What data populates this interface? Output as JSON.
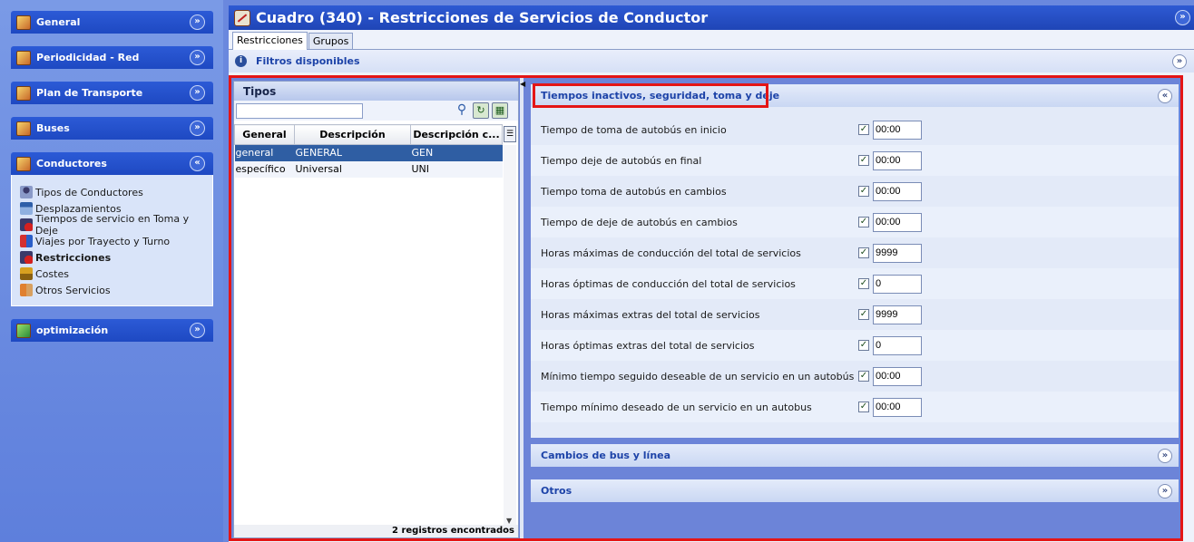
{
  "sidebar": {
    "groups": [
      {
        "title": "General"
      },
      {
        "title": "Periodicidad - Red"
      },
      {
        "title": "Plan de Transporte"
      },
      {
        "title": "Buses"
      },
      {
        "title": "Conductores",
        "items": [
          {
            "label": "Tipos de Conductores"
          },
          {
            "label": "Desplazamientos"
          },
          {
            "label": "Tiempos de servicio en Toma y Deje"
          },
          {
            "label": "Viajes por Trayecto y Turno"
          },
          {
            "label": "Restricciones"
          },
          {
            "label": "Costes"
          },
          {
            "label": "Otros Servicios"
          }
        ]
      },
      {
        "title": "optimización"
      }
    ]
  },
  "window": {
    "title": "Cuadro (340) - Restricciones de Servicios de Conductor"
  },
  "tabs": [
    {
      "label": "Restricciones"
    },
    {
      "label": "Grupos"
    }
  ],
  "filters": {
    "label": "Filtros disponibles"
  },
  "tipos": {
    "title": "Tipos",
    "search_value": "",
    "columns": [
      "General",
      "Descripción",
      "Descripción c..."
    ],
    "rows": [
      {
        "general": "general",
        "descripcion": "GENERAL",
        "descripcion_c": "GEN"
      },
      {
        "general": "específico",
        "descripcion": "Universal",
        "descripcion_c": "UNI"
      }
    ],
    "footer": "2 registros encontrados"
  },
  "sections": {
    "inactivos": {
      "title": "Tiempos inactivos, seguridad, toma y deje",
      "fields": [
        {
          "label": "Tiempo de toma de autobús en inicio",
          "checked": true,
          "value": "00:00"
        },
        {
          "label": "Tiempo deje de autobús en final",
          "checked": true,
          "value": "00:00"
        },
        {
          "label": "Tiempo toma de autobús en cambios",
          "checked": true,
          "value": "00:00"
        },
        {
          "label": "Tiempo de deje de autobús en cambios",
          "checked": true,
          "value": "00:00"
        },
        {
          "label": "Horas máximas de conducción del total de servicios",
          "checked": true,
          "value": "9999"
        },
        {
          "label": "Horas óptimas de conducción del total de servicios",
          "checked": true,
          "value": "0"
        },
        {
          "label": "Horas máximas extras del total de servicios",
          "checked": true,
          "value": "9999"
        },
        {
          "label": "Horas óptimas extras del total de servicios",
          "checked": true,
          "value": "0"
        },
        {
          "label": "Mínimo tiempo seguido deseable de un servicio en un autobús",
          "checked": true,
          "value": "00:00"
        },
        {
          "label": "Tiempo mínimo deseado de un servicio en un autobus",
          "checked": true,
          "value": "00:00"
        }
      ]
    },
    "cambios": {
      "title": "Cambios de bus y línea"
    },
    "otros": {
      "title": "Otros"
    }
  },
  "icons": {
    "collapse": "chevron-double-down-icon",
    "expand": "chevron-double-up-icon"
  },
  "colors": {
    "accent": "#1f45b6",
    "highlight_outline": "#e41515",
    "selected_row": "#2f5ea3"
  }
}
